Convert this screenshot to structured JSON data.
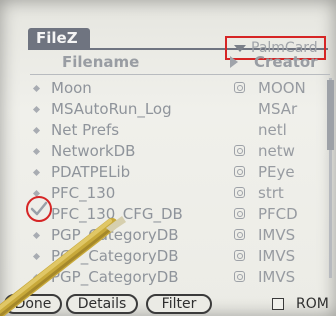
{
  "app": {
    "title": "FileZ",
    "drive": "PalmCard"
  },
  "columns": {
    "filename": "Filename",
    "creator": "Creator"
  },
  "files": [
    {
      "name": "Moon",
      "creator": "MOON",
      "has_icon": true,
      "checked": false
    },
    {
      "name": "MSAutoRun_Log",
      "creator": "MSAr",
      "has_icon": false,
      "checked": false
    },
    {
      "name": "Net Prefs",
      "creator": "netl",
      "has_icon": false,
      "checked": false
    },
    {
      "name": "NetworkDB",
      "creator": "netw",
      "has_icon": true,
      "checked": false
    },
    {
      "name": "PDATPELib",
      "creator": "PEye",
      "has_icon": true,
      "checked": false
    },
    {
      "name": "PFC_130",
      "creator": "strt",
      "has_icon": true,
      "checked": false
    },
    {
      "name": "PFC_130_CFG_DB",
      "creator": "PFCD",
      "has_icon": true,
      "checked": true
    },
    {
      "name": "PGP_CategoryDB",
      "creator": "IMVS",
      "has_icon": true,
      "checked": false
    },
    {
      "name": "PGP_CategoryDB",
      "creator": "IMVS",
      "has_icon": true,
      "checked": false
    },
    {
      "name": "PGP_CategoryDB",
      "creator": "IMVS",
      "has_icon": true,
      "checked": false
    }
  ],
  "toolbar": {
    "done_label": "Done",
    "details_label": "Details",
    "filter_label": "Filter",
    "rom_label": "ROM"
  },
  "colors": {
    "highlight": "#d62525",
    "title_bar": "#6f7480",
    "screen_bg": "#ecece6"
  },
  "icons": {
    "drive_dropdown": "triangle-down-icon",
    "sort_indicator": "triangle-right-icon",
    "file_bullet": "diamond-icon",
    "creator_app": "app-icon",
    "selection": "checkmark-icon"
  }
}
